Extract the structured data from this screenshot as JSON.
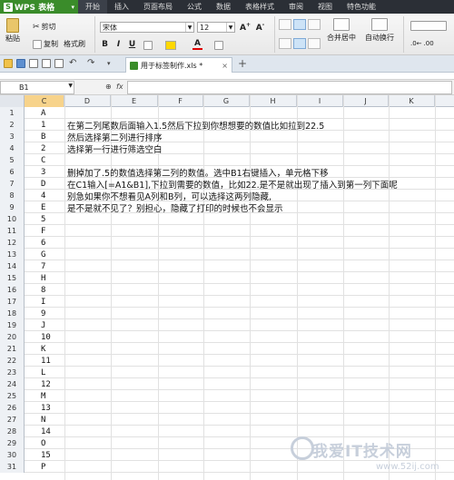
{
  "app": {
    "logo_label": "WPS 表格",
    "menus": [
      "开始",
      "插入",
      "页面布局",
      "公式",
      "数据",
      "表格样式",
      "审阅",
      "视图",
      "特色功能"
    ]
  },
  "ribbon": {
    "paste": "粘贴",
    "cut": "剪切",
    "copy": "复制",
    "format_painter": "格式刷",
    "font_name": "宋体",
    "font_size": "12",
    "merge_center": "合并居中",
    "wrap_text": "自动换行"
  },
  "tabs": {
    "doc_title": "用于标签制作.xls *",
    "new_tab": "+"
  },
  "formula_bar": {
    "cell_ref": "B1",
    "fx_label": "fx",
    "value": ""
  },
  "grid": {
    "columns": [
      "C",
      "D",
      "E",
      "F",
      "G",
      "H",
      "I",
      "J",
      "K"
    ],
    "rows": [
      {
        "n": "1",
        "c": "A",
        "d": ""
      },
      {
        "n": "2",
        "c": "1",
        "d": "在第二列尾数后面输入1.5然后下拉到你想想要的数值比如拉到22.5"
      },
      {
        "n": "3",
        "c": "B",
        "d": "然后选择第二列进行排序"
      },
      {
        "n": "4",
        "c": "2",
        "d": "选择第一行进行筛选空白"
      },
      {
        "n": "5",
        "c": "C",
        "d": ""
      },
      {
        "n": "6",
        "c": "3",
        "d": "删掉加了.5的数值选择第二列的数值。选中B1右键插入，单元格下移"
      },
      {
        "n": "7",
        "c": "D",
        "d": "在C1输入[=A1&B1],下拉到需要的数值，比如22.是不是就出现了插入到第一列下面呢"
      },
      {
        "n": "8",
        "c": "4",
        "d": "别急如果你不想看见A列和B列，可以选择这两列隐藏,"
      },
      {
        "n": "9",
        "c": "E",
        "d": "是不是就不见了？别担心，隐藏了打印的时候也不会显示"
      },
      {
        "n": "10",
        "c": "5",
        "d": ""
      },
      {
        "n": "11",
        "c": "F",
        "d": ""
      },
      {
        "n": "12",
        "c": "6",
        "d": ""
      },
      {
        "n": "13",
        "c": "G",
        "d": ""
      },
      {
        "n": "14",
        "c": "7",
        "d": ""
      },
      {
        "n": "15",
        "c": "H",
        "d": ""
      },
      {
        "n": "16",
        "c": "8",
        "d": ""
      },
      {
        "n": "17",
        "c": "I",
        "d": ""
      },
      {
        "n": "18",
        "c": "9",
        "d": ""
      },
      {
        "n": "19",
        "c": "J",
        "d": ""
      },
      {
        "n": "20",
        "c": "10",
        "d": ""
      },
      {
        "n": "21",
        "c": "K",
        "d": ""
      },
      {
        "n": "22",
        "c": "11",
        "d": ""
      },
      {
        "n": "23",
        "c": "L",
        "d": ""
      },
      {
        "n": "24",
        "c": "12",
        "d": ""
      },
      {
        "n": "25",
        "c": "M",
        "d": ""
      },
      {
        "n": "26",
        "c": "13",
        "d": ""
      },
      {
        "n": "27",
        "c": "N",
        "d": ""
      },
      {
        "n": "28",
        "c": "14",
        "d": ""
      },
      {
        "n": "29",
        "c": "O",
        "d": ""
      },
      {
        "n": "30",
        "c": "15",
        "d": ""
      },
      {
        "n": "31",
        "c": "P",
        "d": ""
      }
    ]
  },
  "watermark": {
    "text": "我爱IT技术网",
    "url": "www.52ij.com"
  }
}
